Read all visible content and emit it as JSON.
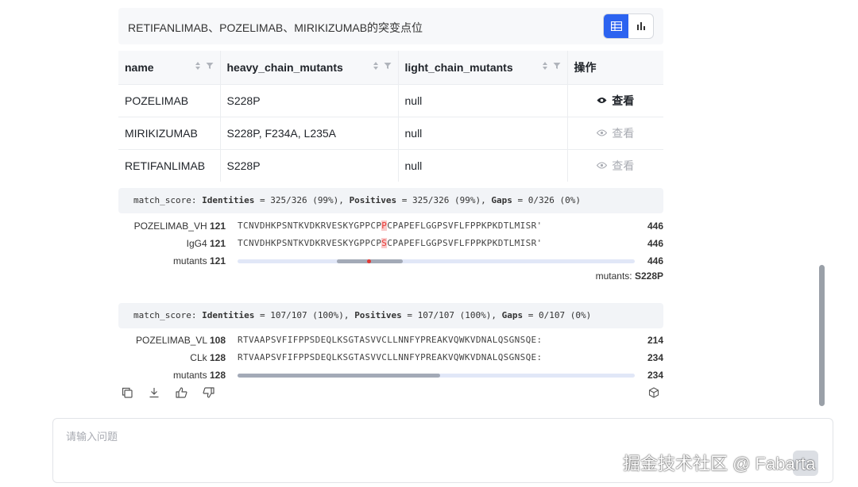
{
  "header": {
    "title": "RETIFANLIMAB、POZELIMAB、MIRIKIZUMAB的突变点位"
  },
  "view_toggle": [
    {
      "icon": "table-icon",
      "active": true
    },
    {
      "icon": "bar-chart-icon",
      "active": false
    }
  ],
  "table": {
    "columns": [
      "name",
      "heavy_chain_mutants",
      "light_chain_mutants",
      "操作"
    ],
    "rows": [
      {
        "name": "POZELIMAB",
        "heavy": "S228P",
        "light": "null",
        "action": "查看"
      },
      {
        "name": "MIRIKIZUMAB",
        "heavy": "S228P, F234A, L235A",
        "light": "null",
        "action": "查看"
      },
      {
        "name": "RETIFANLIMAB",
        "heavy": "S228P",
        "light": "null",
        "action": "查看"
      }
    ]
  },
  "alignments": [
    {
      "score": {
        "prefix": "match_score:",
        "id_label": "Identities",
        "id_val": " = 325/326 (99%), ",
        "pos_label": "Positives",
        "pos_val": " = 325/326 (99%), ",
        "gap_label": "Gaps",
        "gap_val": " = 0/326 (0%)"
      },
      "rows": [
        {
          "name": "POZELIMAB_VH",
          "start": "121",
          "seq_pre": "TCNVDHKPSNTKVDKRVESKYGPPCP",
          "seq_mark": "P",
          "seq_post": "CPAPEFLGGPSVFLFPPKPKDTLMISR'",
          "end": "446"
        },
        {
          "name": "IgG4",
          "start": "121",
          "seq_pre": "TCNVDHKPSNTKVDKRVESKYGPPCP",
          "seq_mark": "S",
          "seq_post": "CPAPEFLGGPSVFLFPPKPKDTLMISR'",
          "end": "446"
        },
        {
          "name": "mutants",
          "start": "121",
          "end": "446",
          "track_from": 0.25,
          "track_to": 0.415,
          "mutation_at": 0.325
        }
      ],
      "mutants_note": {
        "label": "mutants:",
        "value": "S228P"
      }
    },
    {
      "score": {
        "prefix": "match_score:",
        "id_label": "Identities",
        "id_val": " = 107/107 (100%), ",
        "pos_label": "Positives",
        "pos_val": " = 107/107 (100%), ",
        "gap_label": "Gaps",
        "gap_val": " = 0/107 (0%)"
      },
      "rows": [
        {
          "name": "POZELIMAB_VL",
          "start": "108",
          "seq": "RTVAAPSVFIFPPSDEQLKSGTASVVCLLNNFYPREAKVQWKVDNALQSGNSQE:",
          "end": "214"
        },
        {
          "name": "CLk",
          "start": "128",
          "seq": "RTVAAPSVFIFPPSDEQLKSGTASVVCLLNNFYPREAKVQWKVDNALQSGNSQE:",
          "end": "234"
        },
        {
          "name": "mutants",
          "start": "128",
          "end": "234",
          "track_from": 0.0,
          "track_to": 0.51
        }
      ]
    }
  ],
  "actions": [
    "copy-icon",
    "download-icon",
    "thumbs-up-icon",
    "thumbs-down-icon",
    "cube-icon"
  ],
  "input": {
    "placeholder": "请输入问题"
  },
  "watermark": "掘金技术社区 @ Fabarta"
}
